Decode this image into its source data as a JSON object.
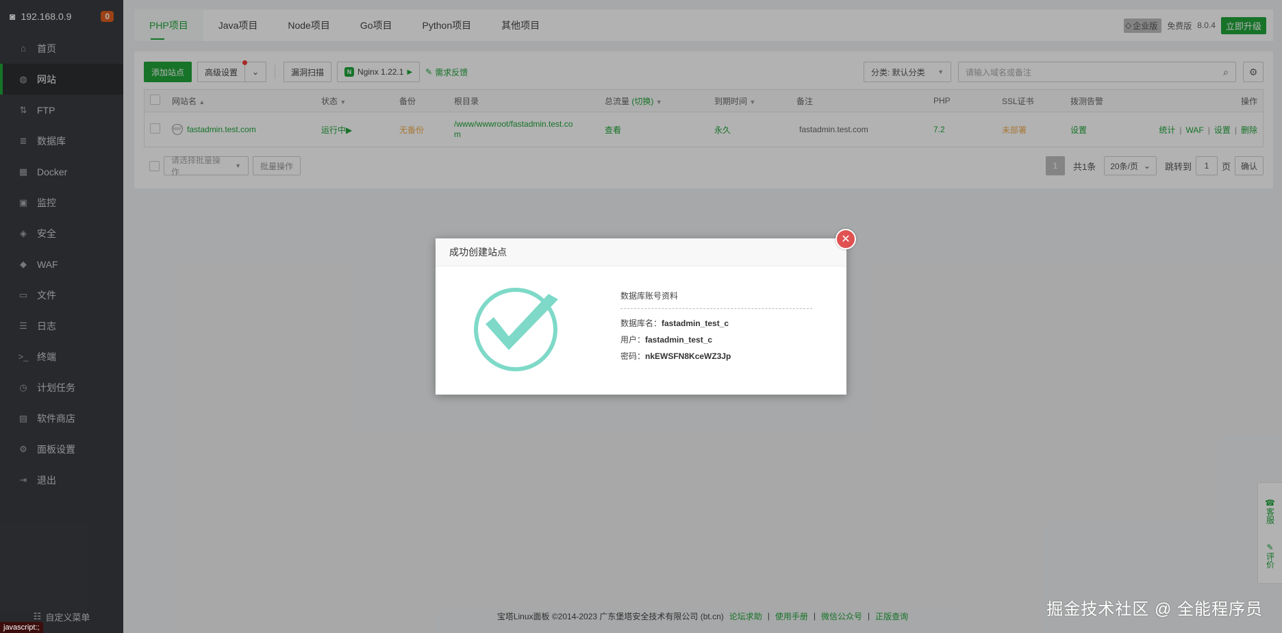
{
  "sidebar": {
    "ip": "192.168.0.9",
    "badge": "0",
    "items": [
      {
        "label": "首页",
        "icon": "home-icon",
        "glyph": "⌂"
      },
      {
        "label": "网站",
        "icon": "globe-icon",
        "glyph": "◍"
      },
      {
        "label": "FTP",
        "icon": "ftp-icon",
        "glyph": "⇅"
      },
      {
        "label": "数据库",
        "icon": "database-icon",
        "glyph": "≣"
      },
      {
        "label": "Docker",
        "icon": "docker-icon",
        "glyph": "▦"
      },
      {
        "label": "监控",
        "icon": "monitor-icon",
        "glyph": "▣"
      },
      {
        "label": "安全",
        "icon": "shield-icon",
        "glyph": "◈"
      },
      {
        "label": "WAF",
        "icon": "waf-icon",
        "glyph": "◆"
      },
      {
        "label": "文件",
        "icon": "folder-icon",
        "glyph": "▭"
      },
      {
        "label": "日志",
        "icon": "log-icon",
        "glyph": "☰"
      },
      {
        "label": "终端",
        "icon": "terminal-icon",
        "glyph": ">_"
      },
      {
        "label": "计划任务",
        "icon": "clock-icon",
        "glyph": "◷"
      },
      {
        "label": "软件商店",
        "icon": "apps-icon",
        "glyph": "▤"
      },
      {
        "label": "面板设置",
        "icon": "settings-icon",
        "glyph": "⚙"
      },
      {
        "label": "退出",
        "icon": "logout-icon",
        "glyph": "⇥"
      }
    ],
    "footer": "自定义菜单"
  },
  "status_bar": "javascript:;",
  "tabs": [
    "PHP项目",
    "Java项目",
    "Node项目",
    "Go项目",
    "Python项目",
    "其他项目"
  ],
  "topbar_right": {
    "enterprise": "企业版",
    "free": "免费版",
    "version": "8.0.4",
    "upgrade": "立即升级"
  },
  "toolbar": {
    "add_site": "添加站点",
    "advanced": "高级设置",
    "vuln_scan": "漏洞扫描",
    "nginx": "Nginx 1.22.1",
    "feedback": "需求反馈",
    "category": "分类: 默认分类",
    "search_placeholder": "请输入域名或备注"
  },
  "table": {
    "headers": [
      "网站名",
      "状态",
      "备份",
      "根目录",
      "总流量",
      "(切换)",
      "到期时间",
      "备注",
      "PHP",
      "SSL证书",
      "拨测告警",
      "操作"
    ],
    "row": {
      "site": "fastadmin.test.com",
      "status": "运行中",
      "backup": "无备份",
      "root": "/www/wwwroot/fastadmin.test.co",
      "root_wrap": "m",
      "traffic": "查看",
      "expire": "永久",
      "note": "fastadmin.test.com",
      "php": "7.2",
      "ssl": "未部署",
      "alert": "设置",
      "ops": [
        "统计",
        "WAF",
        "设置",
        "删除"
      ]
    }
  },
  "bulk": {
    "select_placeholder": "请选择批量操作",
    "bulk_btn": "批量操作"
  },
  "pager": {
    "current": "1",
    "total": "共1条",
    "size": "20条/页",
    "jump_label": "跳转到",
    "jump_value": "1",
    "page_unit": "页",
    "confirm": "确认"
  },
  "footer": {
    "copyright": "宝塔Linux面板 ©2014-2023 广东堡塔安全技术有限公司 (bt.cn)",
    "links": [
      "论坛求助",
      "使用手册",
      "微信公众号",
      "正版查询"
    ]
  },
  "watermark": "掘金技术社区 @ 全能程序员",
  "side_float": [
    "客服",
    "评价"
  ],
  "dialog": {
    "title": "成功创建站点",
    "info_title": "数据库账号资料",
    "db_name_label": "数据库名：",
    "db_name": "fastadmin_test_c",
    "user_label": "用户：",
    "user": "fastadmin_test_c",
    "password_label": "密码：",
    "password": "nkEWSFN8KceWZ3Jp"
  },
  "colors": {
    "accent": "#20a53a",
    "sidebar_bg": "#3a3c40",
    "check": "#7ed9c8",
    "close_btn": "#e05252"
  }
}
